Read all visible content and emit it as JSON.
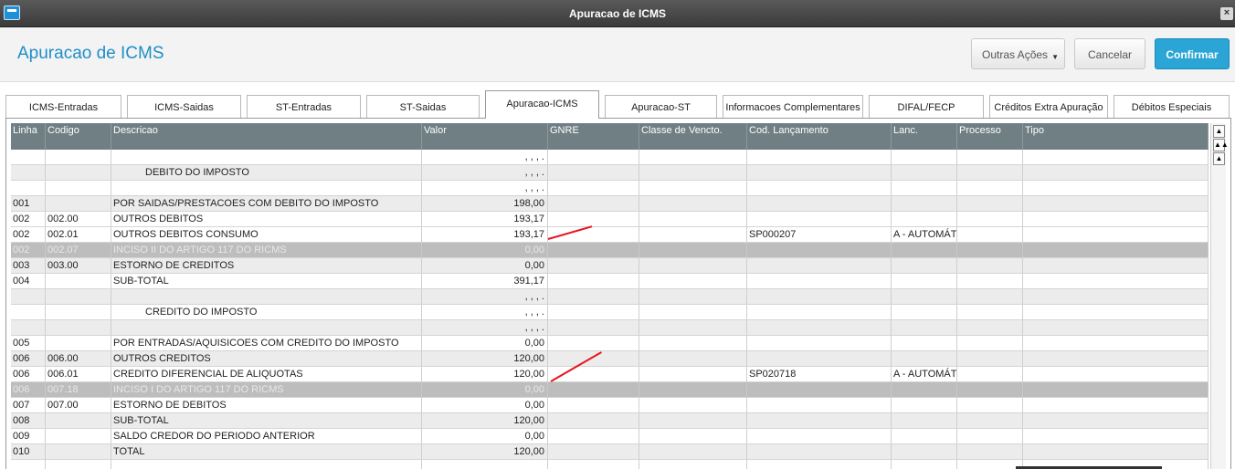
{
  "window": {
    "title": "Apuracao de ICMS",
    "close_label": "×"
  },
  "header": {
    "page_title": "Apuracao de ICMS",
    "more_actions_label": "Outras Ações",
    "cancel_label": "Cancelar",
    "confirm_label": "Confirmar"
  },
  "tabs": [
    "ICMS-Entradas",
    "ICMS-Saidas",
    "ST-Entradas",
    "ST-Saidas",
    "Apuracao-ICMS",
    "Apuracao-ST",
    "Informacoes Complementares",
    "DIFAL/FECP",
    "Créditos Extra Apuração",
    "Débitos Especiais"
  ],
  "active_tab": "Apuracao-ICMS",
  "grid": {
    "columns": [
      "Linha",
      "Codigo",
      "Descricao",
      "Valor",
      "GNRE",
      "Classe de Vencto.",
      "Cod. Lançamento",
      "Lanc.",
      "Processo",
      "Tipo"
    ],
    "rows": [
      {
        "linha": "",
        "codigo": "",
        "descricao": "",
        "valor": ", , , .",
        "cod": "",
        "lanc": "",
        "style": ""
      },
      {
        "linha": "",
        "codigo": "",
        "descricao": "DEBITO DO IMPOSTO",
        "valor": ", , , .",
        "cod": "",
        "lanc": "",
        "style": "alt",
        "indent": true
      },
      {
        "linha": "",
        "codigo": "",
        "descricao": "",
        "valor": ", , , .",
        "cod": "",
        "lanc": "",
        "style": ""
      },
      {
        "linha": "001",
        "codigo": "",
        "descricao": "POR SAIDAS/PRESTACOES COM DEBITO DO IMPOSTO",
        "valor": "198,00",
        "cod": "",
        "lanc": "",
        "style": "alt"
      },
      {
        "linha": "002",
        "codigo": "002.00",
        "descricao": "OUTROS DEBITOS",
        "valor": "193,17",
        "cod": "",
        "lanc": "",
        "style": ""
      },
      {
        "linha": "002",
        "codigo": "002.01",
        "descricao": "OUTROS DEBITOS CONSUMO",
        "valor": "193,17",
        "cod": "SP000207",
        "lanc": "A  - AUTOMÁTICO",
        "style": ""
      },
      {
        "linha": "002",
        "codigo": "002.07",
        "descricao": "INCISO II DO ARTIGO 117 DO RICMS",
        "valor": "0,00",
        "cod": "",
        "lanc": "",
        "style": "dim"
      },
      {
        "linha": "003",
        "codigo": "003.00",
        "descricao": "ESTORNO DE CREDITOS",
        "valor": "0,00",
        "cod": "",
        "lanc": "",
        "style": "alt"
      },
      {
        "linha": "004",
        "codigo": "",
        "descricao": "SUB-TOTAL",
        "valor": "391,17",
        "cod": "",
        "lanc": "",
        "style": ""
      },
      {
        "linha": "",
        "codigo": "",
        "descricao": "",
        "valor": ", , , .",
        "cod": "",
        "lanc": "",
        "style": "alt"
      },
      {
        "linha": "",
        "codigo": "",
        "descricao": "CREDITO DO IMPOSTO",
        "valor": ", , , .",
        "cod": "",
        "lanc": "",
        "style": "",
        "indent": true
      },
      {
        "linha": "",
        "codigo": "",
        "descricao": "",
        "valor": ", , , .",
        "cod": "",
        "lanc": "",
        "style": "alt"
      },
      {
        "linha": "005",
        "codigo": "",
        "descricao": "POR ENTRADAS/AQUISICOES COM CREDITO DO IMPOSTO",
        "valor": "0,00",
        "cod": "",
        "lanc": "",
        "style": ""
      },
      {
        "linha": "006",
        "codigo": "006.00",
        "descricao": "OUTROS CREDITOS",
        "valor": "120,00",
        "cod": "",
        "lanc": "",
        "style": "alt"
      },
      {
        "linha": "006",
        "codigo": "006.01",
        "descricao": "CREDITO DIFERENCIAL DE ALIQUOTAS",
        "valor": "120,00",
        "cod": "SP020718",
        "lanc": "A  - AUTOMÁTICO",
        "style": ""
      },
      {
        "linha": "006",
        "codigo": "007.18",
        "descricao": "INCISO I DO ARTIGO 117 DO RICMS",
        "valor": "0,00",
        "cod": "",
        "lanc": "",
        "style": "dim"
      },
      {
        "linha": "007",
        "codigo": "007.00",
        "descricao": "ESTORNO DE DEBITOS",
        "valor": "0,00",
        "cod": "",
        "lanc": "",
        "style": ""
      },
      {
        "linha": "008",
        "codigo": "",
        "descricao": "SUB-TOTAL",
        "valor": "120,00",
        "cod": "",
        "lanc": "",
        "style": "alt"
      },
      {
        "linha": "009",
        "codigo": "",
        "descricao": "SALDO CREDOR DO PERIODO ANTERIOR",
        "valor": "0,00",
        "cod": "",
        "lanc": "",
        "style": ""
      },
      {
        "linha": "010",
        "codigo": "",
        "descricao": "TOTAL",
        "valor": "120,00",
        "cod": "",
        "lanc": "",
        "style": "alt"
      },
      {
        "linha": "",
        "codigo": "",
        "descricao": "",
        "valor": "",
        "cod": "",
        "lanc": "",
        "style": ""
      }
    ]
  },
  "scrollbar": {
    "top_icon": "scroll-top-icon",
    "page_up_icon": "scroll-page-up-icon",
    "up_icon": "scroll-up-icon"
  },
  "colors": {
    "accent": "#1f8fc6",
    "confirm": "#2aa5d6",
    "grid_header": "#6f7f84",
    "annotation_red": "#e8141e"
  }
}
